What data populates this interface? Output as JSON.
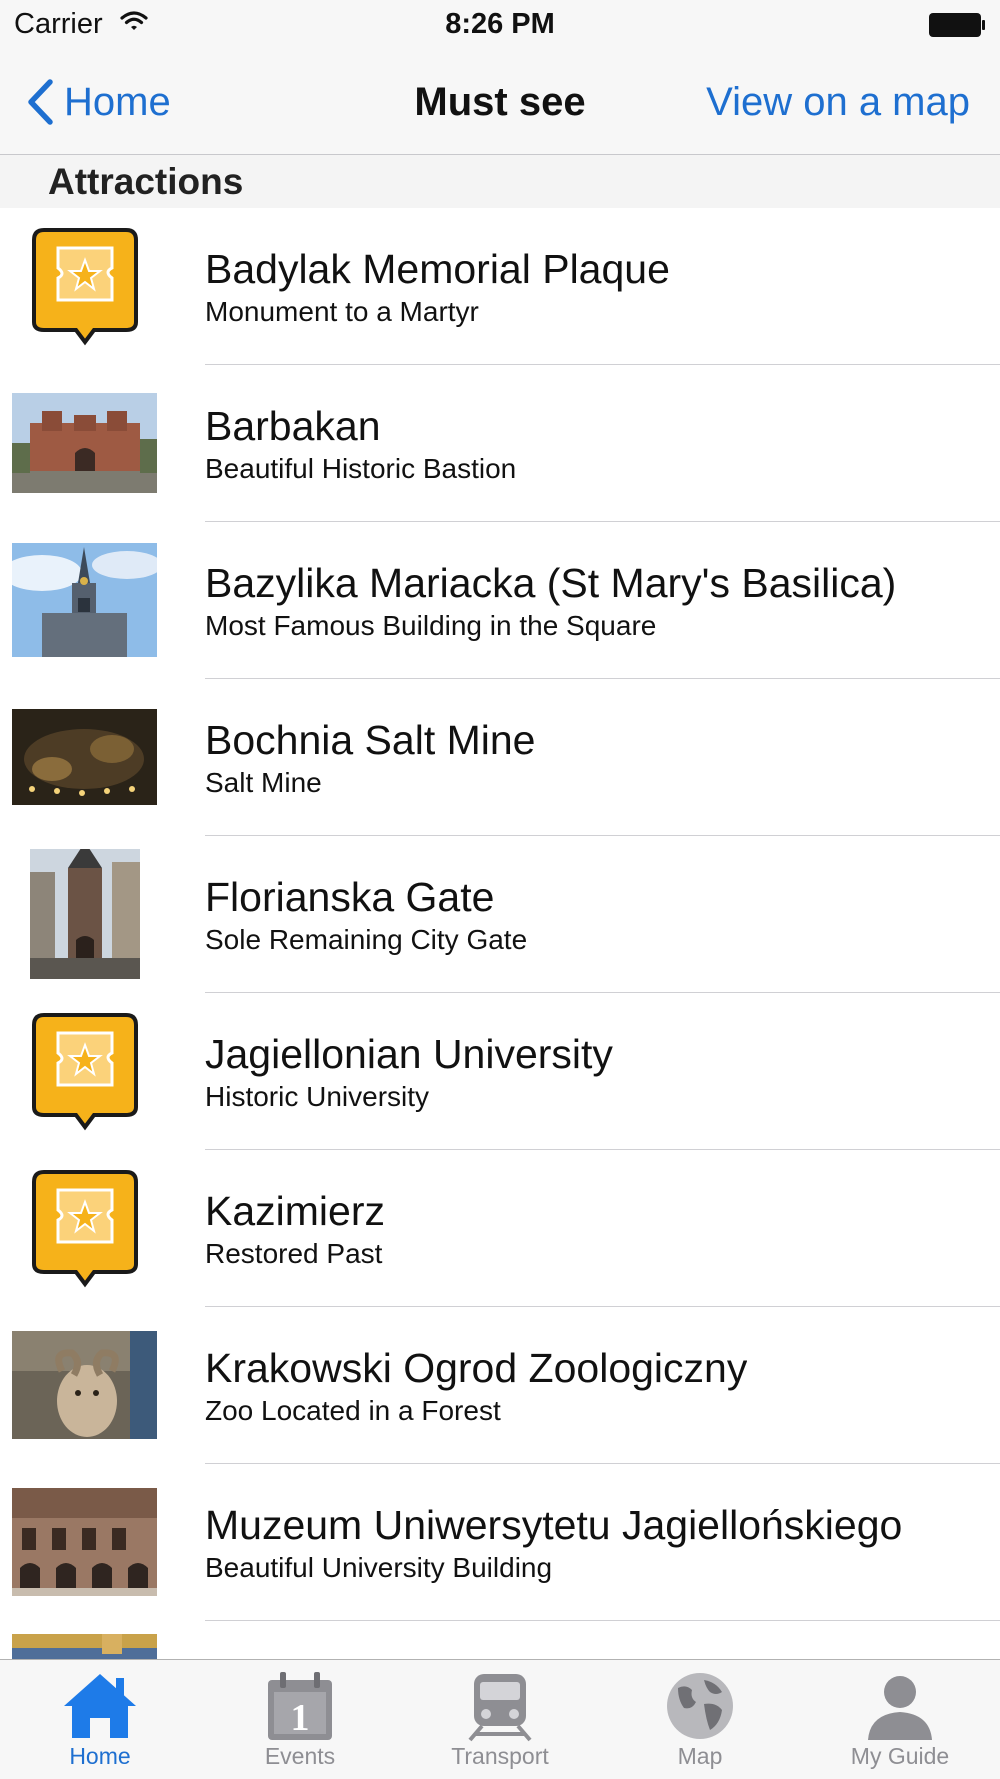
{
  "status_bar": {
    "carrier": "Carrier",
    "time": "8:26 PM"
  },
  "nav": {
    "back_label": "Home",
    "title": "Must see",
    "right_label": "View on a map"
  },
  "section": {
    "title": "Attractions"
  },
  "items": [
    {
      "title": "Badylak Memorial Plaque",
      "subtitle": "Monument to a Martyr",
      "icon": "ticket-pin-icon"
    },
    {
      "title": "Barbakan",
      "subtitle": "Beautiful Historic Bastion",
      "icon": "photo-barbakan"
    },
    {
      "title": "Bazylika Mariacka (St Mary's Basilica)",
      "subtitle": "Most Famous Building in the Square",
      "icon": "photo-basilica"
    },
    {
      "title": "Bochnia Salt Mine",
      "subtitle": "Salt Mine",
      "icon": "photo-salt-mine"
    },
    {
      "title": "Florianska Gate",
      "subtitle": "Sole Remaining City Gate",
      "icon": "photo-gate"
    },
    {
      "title": "Jagiellonian University",
      "subtitle": "Historic University",
      "icon": "ticket-pin-icon"
    },
    {
      "title": "Kazimierz",
      "subtitle": "Restored Past",
      "icon": "ticket-pin-icon"
    },
    {
      "title": "Krakowski Ogrod Zoologiczny",
      "subtitle": "Zoo Located in a Forest",
      "icon": "photo-zoo"
    },
    {
      "title": "Muzeum Uniwersytetu Jagiellońskiego",
      "subtitle": "Beautiful University Building",
      "icon": "photo-museum"
    },
    {
      "title": "",
      "subtitle": "",
      "icon": "photo-partial"
    }
  ],
  "tabs": [
    {
      "label": "Home",
      "icon": "home-icon",
      "active": true
    },
    {
      "label": "Events",
      "icon": "calendar-icon",
      "active": false
    },
    {
      "label": "Transport",
      "icon": "train-icon",
      "active": false
    },
    {
      "label": "Map",
      "icon": "globe-icon",
      "active": false
    },
    {
      "label": "My Guide",
      "icon": "person-icon",
      "active": false
    }
  ],
  "colors": {
    "accent": "#1e6fd0",
    "ticket_yellow": "#f6b21a",
    "inactive_tab": "#8e8e93"
  }
}
